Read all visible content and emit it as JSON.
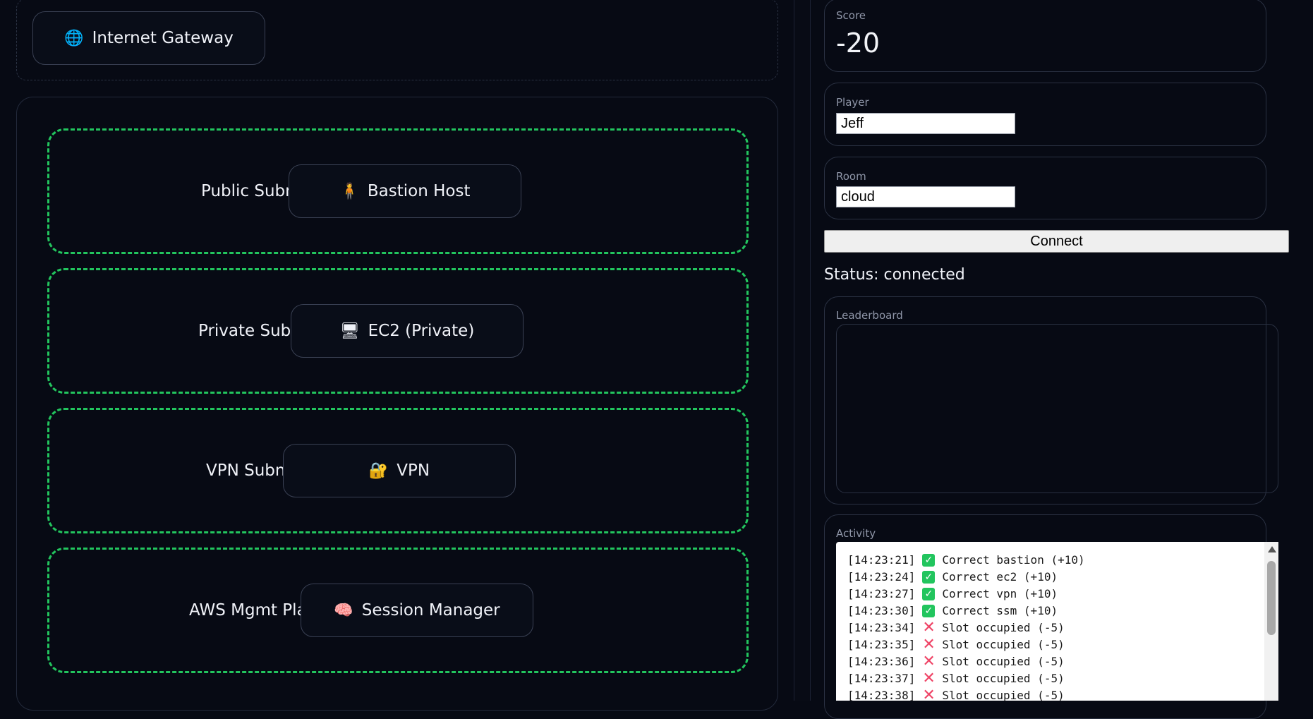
{
  "diagram": {
    "gateway": {
      "icon": "globe-icon",
      "glyph": "🌐",
      "label": "Internet Gateway"
    },
    "subnets": [
      {
        "label": "Public Subnet",
        "node": {
          "icon": "person-icon",
          "glyph": "🧍",
          "label": "Bastion Host"
        }
      },
      {
        "label": "Private Subnet",
        "node": {
          "icon": "server-icon",
          "glyph": "🖥",
          "label": "EC2 (Private)"
        }
      },
      {
        "label": "VPN Subnet",
        "node": {
          "icon": "lock-key-icon",
          "glyph": "🔐",
          "label": "VPN"
        }
      },
      {
        "label": "AWS Mgmt Plane",
        "node": {
          "icon": "brain-icon",
          "glyph": "🧠",
          "label": "Session Manager"
        }
      }
    ],
    "subnet_border_color": "#22c55e"
  },
  "panel": {
    "score_label": "Score",
    "score_value": "-20",
    "player_label": "Player",
    "player_value": "Jeff",
    "room_label": "Room",
    "room_value": "cloud",
    "connect_label": "Connect",
    "status_text": "Status: connected",
    "leaderboard_label": "Leaderboard",
    "activity_label": "Activity"
  },
  "activity": [
    {
      "time": "[14:23:21]",
      "mark": "ok",
      "text": "Correct bastion (+10)"
    },
    {
      "time": "[14:23:24]",
      "mark": "ok",
      "text": "Correct ec2 (+10)"
    },
    {
      "time": "[14:23:27]",
      "mark": "ok",
      "text": "Correct vpn (+10)"
    },
    {
      "time": "[14:23:30]",
      "mark": "ok",
      "text": "Correct ssm (+10)"
    },
    {
      "time": "[14:23:34]",
      "mark": "bad",
      "text": "Slot occupied (-5)"
    },
    {
      "time": "[14:23:35]",
      "mark": "bad",
      "text": "Slot occupied (-5)"
    },
    {
      "time": "[14:23:36]",
      "mark": "bad",
      "text": "Slot occupied (-5)"
    },
    {
      "time": "[14:23:37]",
      "mark": "bad",
      "text": "Slot occupied (-5)"
    },
    {
      "time": "[14:23:38]",
      "mark": "bad",
      "text": "Slot occupied (-5)"
    }
  ]
}
